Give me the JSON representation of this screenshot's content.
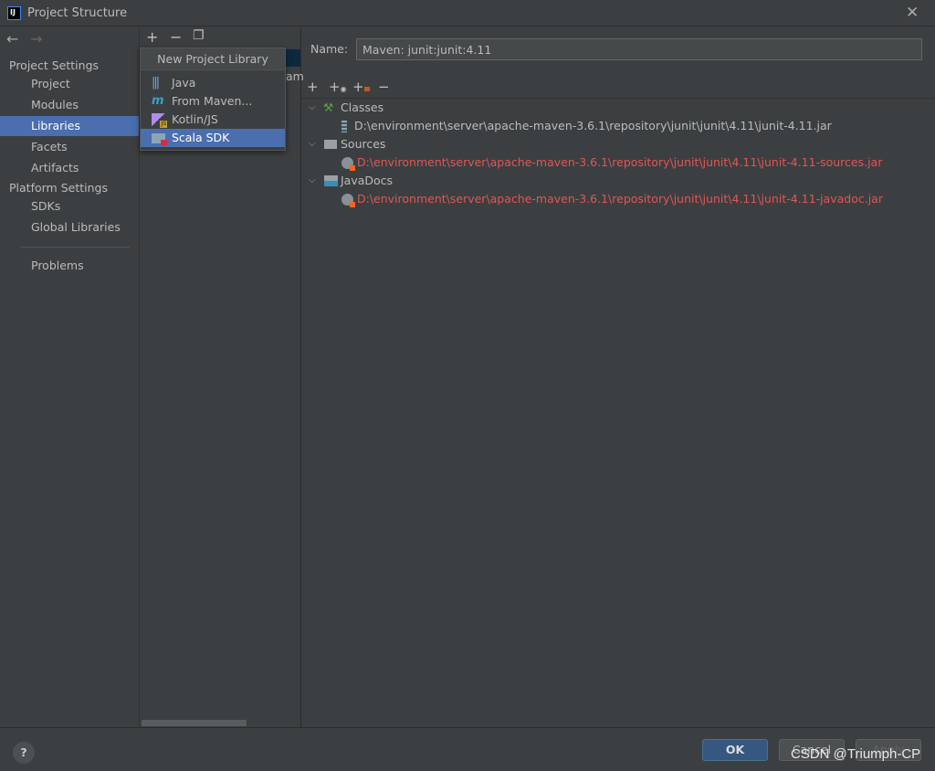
{
  "window": {
    "title": "Project Structure",
    "app_icon": "IJ"
  },
  "sidebar": {
    "project_settings": "Project Settings",
    "project_items": [
      {
        "label": "Project"
      },
      {
        "label": "Modules"
      },
      {
        "label": "Libraries",
        "selected": true
      },
      {
        "label": "Facets"
      },
      {
        "label": "Artifacts"
      }
    ],
    "platform_settings": "Platform Settings",
    "platform_items": [
      {
        "label": "SDKs"
      },
      {
        "label": "Global Libraries"
      }
    ],
    "problems": "Problems"
  },
  "middle": {
    "partial_text": "am"
  },
  "popup": {
    "title": "New Project Library",
    "items": [
      {
        "label": "Java",
        "icon": "java-library-icon"
      },
      {
        "label": "From Maven...",
        "icon": "maven-icon"
      },
      {
        "label": "Kotlin/JS",
        "icon": "kotlin-js-icon"
      },
      {
        "label": "Scala SDK",
        "icon": "scala-sdk-icon",
        "selected": true
      }
    ]
  },
  "detail": {
    "name_label": "Name:",
    "name_value": "Maven: junit:junit:4.11",
    "tree": [
      {
        "label": "Classes",
        "icon": "hammer-icon",
        "children": [
          {
            "path": "D:\\environment\\server\\apache-maven-3.6.1\\repository\\junit\\junit\\4.11\\junit-4.11.jar",
            "missing": false
          }
        ]
      },
      {
        "label": "Sources",
        "icon": "sources-folder-icon",
        "children": [
          {
            "path": "D:\\environment\\server\\apache-maven-3.6.1\\repository\\junit\\junit\\4.11\\junit-4.11-sources.jar",
            "missing": true
          }
        ]
      },
      {
        "label": "JavaDocs",
        "icon": "javadoc-folder-icon",
        "children": [
          {
            "path": "D:\\environment\\server\\apache-maven-3.6.1\\repository\\junit\\junit\\4.11\\junit-4.11-javadoc.jar",
            "missing": true
          }
        ]
      }
    ]
  },
  "buttons": {
    "ok": "OK",
    "cancel": "Cancel",
    "apply": "Apply",
    "help": "?"
  },
  "watermark": "CSDN @Triumph-CP",
  "colors": {
    "selection": "#4b6eaf",
    "missing_path": "#e05555",
    "ok_button": "#365880"
  }
}
